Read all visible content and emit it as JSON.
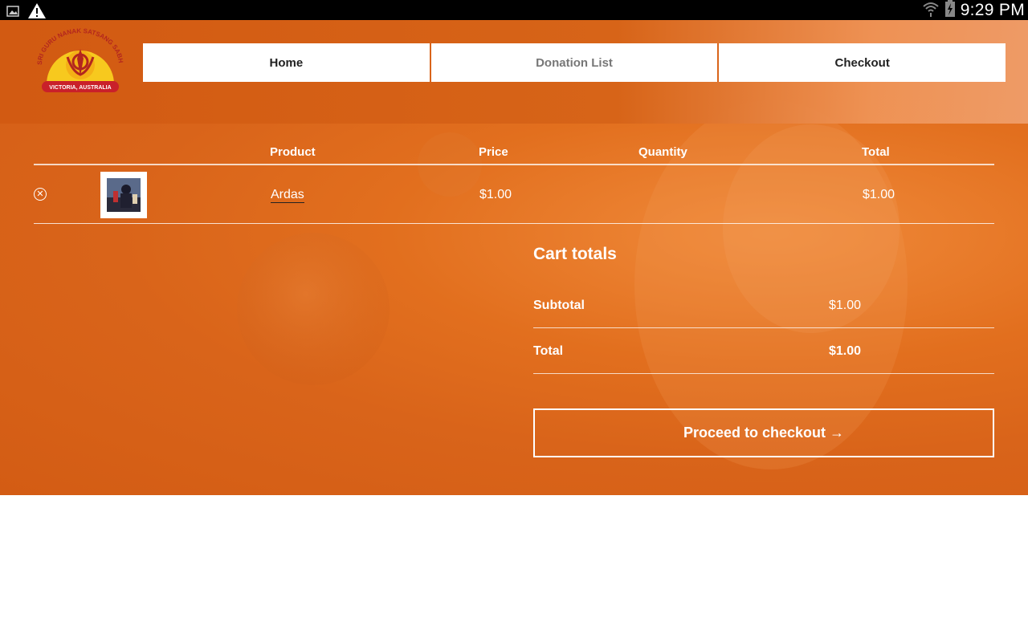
{
  "status_bar": {
    "time": "9:29 PM",
    "icons": [
      "image-icon",
      "warning-icon",
      "wifi-icon",
      "battery-charging-icon"
    ]
  },
  "header": {
    "logo": {
      "arc_text": "SRI GURU NANAK SATSANG SABHA",
      "banner_text": "VICTORIA, AUSTRALIA"
    },
    "nav": [
      {
        "label": "Home"
      },
      {
        "label": "Donation List"
      },
      {
        "label": "Checkout"
      }
    ]
  },
  "cart": {
    "headers": {
      "product": "Product",
      "price": "Price",
      "quantity": "Quantity",
      "total": "Total"
    },
    "items": [
      {
        "name": "Ardas",
        "price": "$1.00",
        "total": "$1.00"
      }
    ]
  },
  "totals": {
    "title": "Cart totals",
    "subtotal_label": "Subtotal",
    "subtotal_value": "$1.00",
    "total_label": "Total",
    "total_value": "$1.00",
    "checkout_label": "Proceed to checkout →"
  },
  "colors": {
    "accent": "#d9641a",
    "nav_bg": "#ffffff",
    "text_on_accent": "#ffffff"
  }
}
